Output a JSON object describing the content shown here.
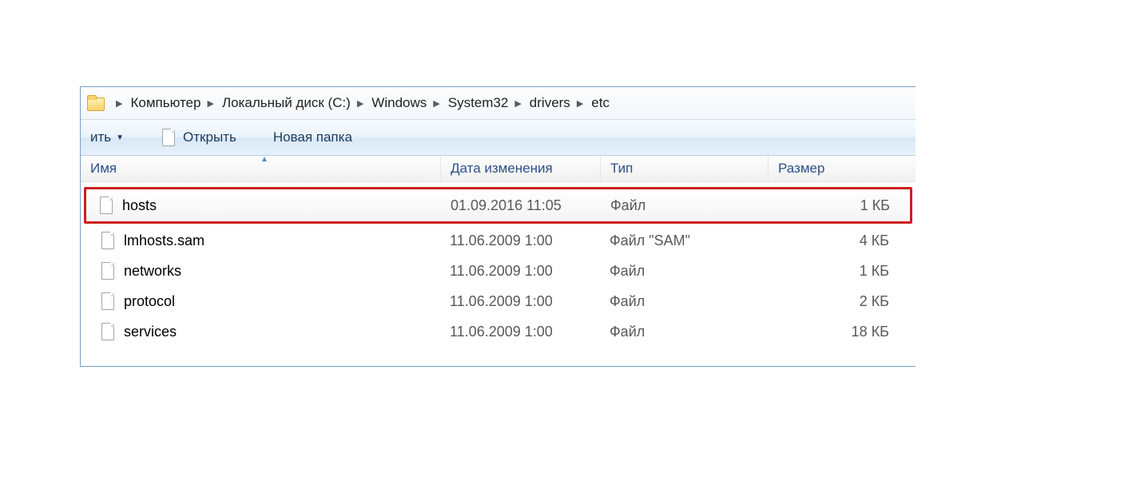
{
  "breadcrumb": {
    "items": [
      {
        "label": "Компьютер"
      },
      {
        "label": "Локальный диск (C:)"
      },
      {
        "label": "Windows"
      },
      {
        "label": "System32"
      },
      {
        "label": "drivers"
      },
      {
        "label": "etc"
      }
    ]
  },
  "toolbar": {
    "organize_fragment": "ить",
    "open_label": "Открыть",
    "new_folder_label": "Новая папка"
  },
  "columns": {
    "name": "Имя",
    "date": "Дата изменения",
    "type": "Тип",
    "size": "Размер"
  },
  "files": [
    {
      "name": "hosts",
      "date": "01.09.2016 11:05",
      "type": "Файл",
      "size": "1 КБ",
      "highlight": true
    },
    {
      "name": "lmhosts.sam",
      "date": "11.06.2009 1:00",
      "type": "Файл \"SAM\"",
      "size": "4 КБ",
      "highlight": false
    },
    {
      "name": "networks",
      "date": "11.06.2009 1:00",
      "type": "Файл",
      "size": "1 КБ",
      "highlight": false
    },
    {
      "name": "protocol",
      "date": "11.06.2009 1:00",
      "type": "Файл",
      "size": "2 КБ",
      "highlight": false
    },
    {
      "name": "services",
      "date": "11.06.2009 1:00",
      "type": "Файл",
      "size": "18 КБ",
      "highlight": false
    }
  ]
}
